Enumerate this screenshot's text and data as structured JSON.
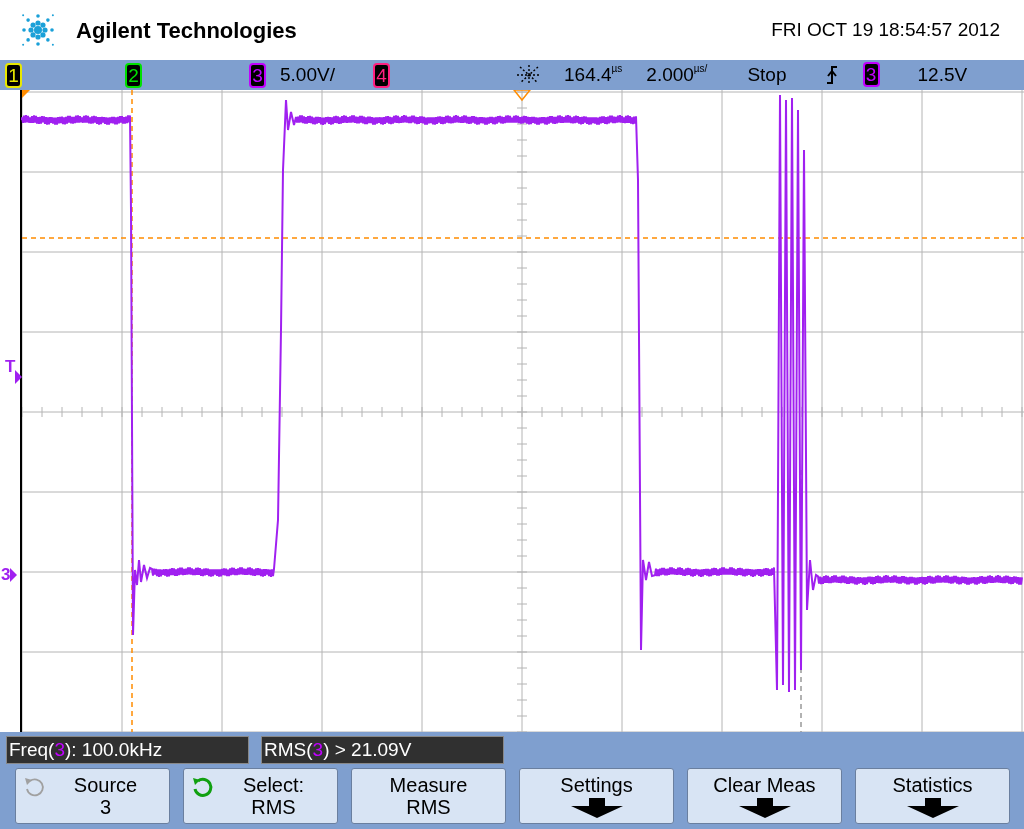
{
  "header": {
    "brand": "Agilent Technologies",
    "datetime": "FRI OCT 19 18:54:57 2012"
  },
  "channel_bar": {
    "channels": [
      {
        "label": "1",
        "color": "#e8e800"
      },
      {
        "label": "2",
        "color": "#00e000"
      },
      {
        "label": "3",
        "color": "#c000ff",
        "scale": "5.00V/"
      },
      {
        "label": "4",
        "color": "#ff2080"
      }
    ],
    "delay": {
      "value": "164.4",
      "unit": "µs"
    },
    "timebase": {
      "value": "2.000",
      "unit": "µs/"
    },
    "run_state": "Stop",
    "trigger": {
      "channel": "3",
      "color": "#c000ff",
      "level": "12.5V"
    }
  },
  "display": {
    "markers": [
      {
        "kind": "trigger",
        "label": "T"
      },
      {
        "kind": "ground",
        "label": "3"
      }
    ]
  },
  "measurements": [
    {
      "prefix": "Freq(",
      "channel": "3",
      "suffix": "): 100.0kHz"
    },
    {
      "prefix": "RMS(",
      "channel": "3",
      "suffix": ") > 21.09V"
    }
  ],
  "softkeys": [
    {
      "line1": "Source",
      "line2": "3",
      "knob_active": false,
      "submenu": false
    },
    {
      "line1": "Select:",
      "line2": "RMS",
      "knob_active": true,
      "submenu": false
    },
    {
      "line1": "Measure",
      "line2": "RMS",
      "submenu": false
    },
    {
      "line1": "Settings",
      "submenu": true
    },
    {
      "line1": "Clear Meas",
      "submenu": true
    },
    {
      "line1": "Statistics",
      "submenu": true
    }
  ]
}
